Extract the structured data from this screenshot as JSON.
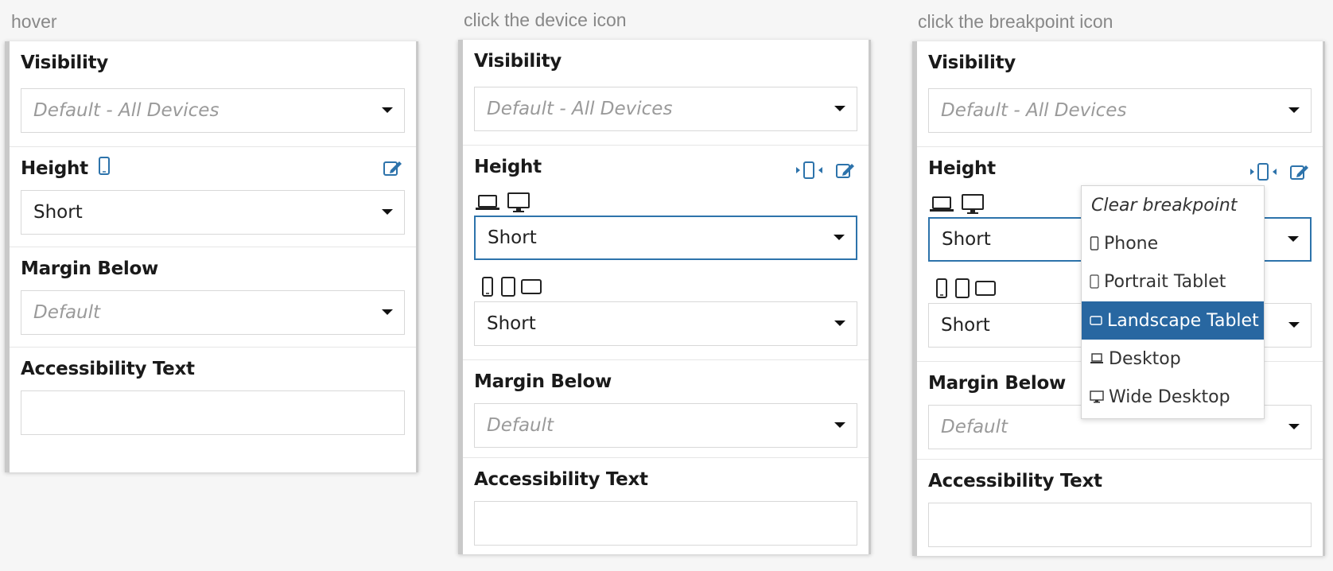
{
  "captions": [
    "hover",
    "click the device icon",
    "click the breakpoint icon"
  ],
  "labels": {
    "visibility": "Visibility",
    "height": "Height",
    "margin_below": "Margin Below",
    "accessibility_text": "Accessibility Text"
  },
  "values": {
    "visibility": "Default - All Devices",
    "height": "Short",
    "margin_below": "Default"
  },
  "breakpoint_menu": {
    "clear": "Clear breakpoint",
    "items": [
      "Phone",
      "Portrait Tablet",
      "Landscape Tablet",
      "Desktop",
      "Wide Desktop"
    ],
    "selected": "Landscape Tablet"
  },
  "colors": {
    "accent": "#2d73ab",
    "selected_bg": "#2867a1"
  }
}
